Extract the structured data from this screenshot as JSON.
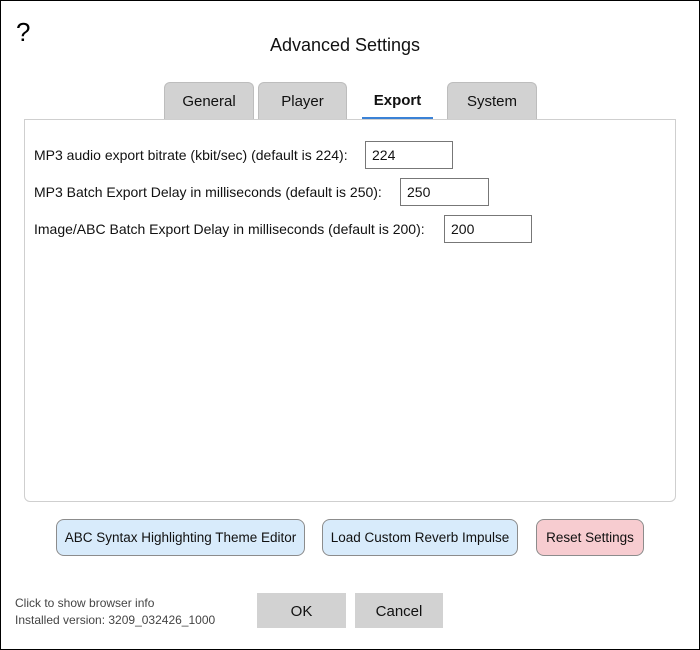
{
  "dialog": {
    "help_glyph": "?",
    "title": "Advanced Settings"
  },
  "tabs": [
    {
      "label": "General",
      "active": false
    },
    {
      "label": "Player",
      "active": false
    },
    {
      "label": "Export",
      "active": true
    },
    {
      "label": "System",
      "active": false
    }
  ],
  "export": {
    "mp3_bitrate": {
      "label": "MP3 audio export bitrate (kbit/sec) (default is 224):",
      "value": "224"
    },
    "mp3_batch_delay": {
      "label": "MP3 Batch Export Delay in milliseconds (default is 250):",
      "value": "250"
    },
    "image_abc_batch_delay": {
      "label": "Image/ABC Batch Export Delay in milliseconds (default is 200):",
      "value": "200"
    }
  },
  "action_buttons": {
    "theme_editor": "ABC Syntax Highlighting Theme Editor",
    "load_reverb": "Load Custom Reverb Impulse",
    "reset_settings": "Reset Settings"
  },
  "footer": {
    "browser_info": "Click to show browser info",
    "installed_version": "Installed version: 3209_032426_1000",
    "ok_label": "OK",
    "cancel_label": "Cancel"
  },
  "colors": {
    "active_tab_accent": "#3b82d6",
    "blue_button": "#d8ebfb",
    "reset_button": "#f7ccd0",
    "gray_button": "#d2d2d2"
  }
}
